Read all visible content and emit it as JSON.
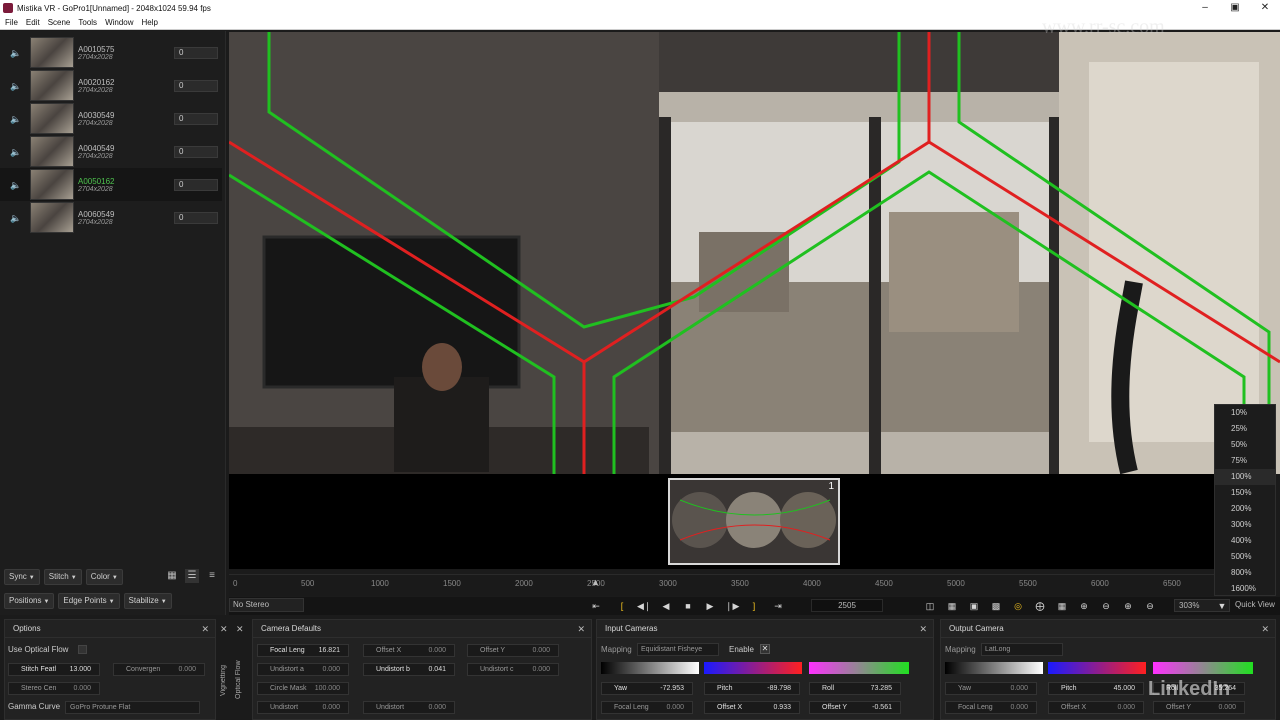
{
  "window": {
    "title": "Mistika VR - GoPro1[Unnamed] - 2048x1024 59.94 fps"
  },
  "menu": [
    "File",
    "Edit",
    "Scene",
    "Tools",
    "Window",
    "Help"
  ],
  "clips": [
    {
      "name": "A0010575",
      "res": "2704x2028",
      "value": "0"
    },
    {
      "name": "A0020162",
      "res": "2704x2028",
      "value": "0"
    },
    {
      "name": "A0030549",
      "res": "2704x2028",
      "value": "0"
    },
    {
      "name": "A0040549",
      "res": "2704x2028",
      "value": "0"
    },
    {
      "name": "A0050162",
      "res": "2704x2028",
      "value": "0"
    },
    {
      "name": "A0060549",
      "res": "2704x2028",
      "value": "0"
    }
  ],
  "left_buttons": {
    "row1": [
      "Sync",
      "Stitch",
      "Color"
    ],
    "row2": [
      "Positions",
      "Edge Points",
      "Stabilize"
    ]
  },
  "zoom_options": [
    "10%",
    "25%",
    "50%",
    "75%",
    "100%",
    "150%",
    "200%",
    "300%",
    "400%",
    "500%",
    "800%",
    "1600%"
  ],
  "minimap": {
    "index": "1"
  },
  "timeline_ticks": [
    "0",
    "500",
    "1000",
    "1500",
    "2000",
    "2500",
    "3000",
    "3500",
    "4000",
    "4500",
    "5000",
    "5500",
    "6000",
    "6500"
  ],
  "transport": {
    "stereo": "No Stereo",
    "frame": "2505",
    "zoom": "303%",
    "quick_view": "Quick View"
  },
  "options": {
    "title": "Options",
    "use_optical_flow": "Use Optical Flow",
    "stitch_label": "Stitch Featl",
    "stitch_value": "13.000",
    "convergence_label": "Convergen",
    "convergence_value": "0.000",
    "stereo_label": "Stereo Cen",
    "stereo_value": "0.000",
    "gamma_label": "Gamma Curve",
    "gamma_value": "GoPro Protune Flat"
  },
  "vtabs": [
    "Vignetting",
    "Optical Flow"
  ],
  "camera_defaults": {
    "title": "Camera Defaults",
    "focal_label": "Focal Leng",
    "focal_value": "16.821",
    "offx_label": "Offset X",
    "offx_value": "0.000",
    "offy_label": "Offset Y",
    "offy_value": "0.000",
    "undist_a_label": "Undistort a",
    "undist_a_value": "0.000",
    "undist_b_label": "Undistort b",
    "undist_b_value": "0.041",
    "undist_c_label": "Undistort c",
    "undist_c_value": "0.000",
    "circle_label": "Circle Mask",
    "circle_value": "100.000",
    "undist_d_label": "Undistort",
    "undist_d_value": "0.000",
    "undist_e_label": "Undistort",
    "undist_e_value": "0.000"
  },
  "input_cameras": {
    "title": "Input Cameras",
    "mapping_label": "Mapping",
    "mapping_value": "Equidistant Fisheye",
    "enable_label": "Enable",
    "yaw_label": "Yaw",
    "yaw_value": "-72.953",
    "pitch_label": "Pitch",
    "pitch_value": "-89.798",
    "roll_label": "Roll",
    "roll_value": "73.285",
    "focal_label": "Focal Leng",
    "focal_value": "0.000",
    "offx_label": "Offset X",
    "offx_value": "0.933",
    "offy_label": "Offset Y",
    "offy_value": "-0.561"
  },
  "output_camera": {
    "title": "Output Camera",
    "mapping_label": "Mapping",
    "mapping_value": "LatLong",
    "yaw_label": "Yaw",
    "yaw_value": "0.000",
    "pitch_label": "Pitch",
    "pitch_value": "45.000",
    "roll_label": "Roll",
    "roll_value": "35.264",
    "focal_label": "Focal Leng",
    "focal_value": "0.000",
    "offx_label": "Offset X",
    "offx_value": "0.000",
    "offy_label": "Offset Y",
    "offy_value": "0.000"
  },
  "watermark": "www.rr-sc.com",
  "branding": "LinkedIn",
  "colors": {
    "accent_green": "#4ec24e",
    "seam_red": "#e02020",
    "seam_green": "#20c020",
    "marker_yellow": "#f0c020"
  }
}
